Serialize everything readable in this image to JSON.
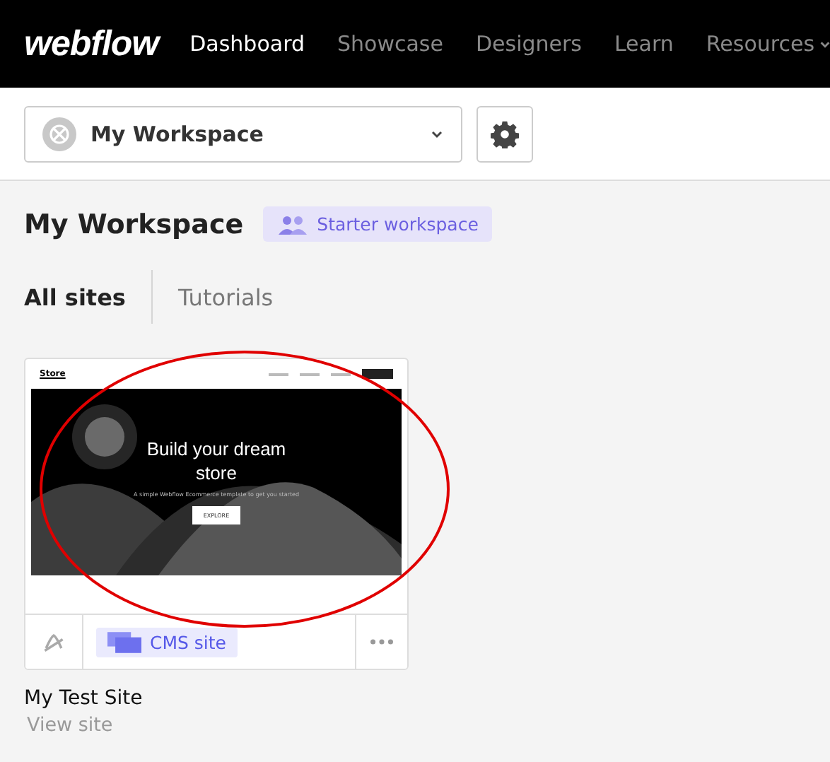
{
  "nav": {
    "logo": "webflow",
    "items": [
      {
        "label": "Dashboard",
        "selected": true
      },
      {
        "label": "Showcase",
        "selected": false
      },
      {
        "label": "Designers",
        "selected": false
      },
      {
        "label": "Learn",
        "selected": false
      },
      {
        "label": "Resources",
        "selected": false,
        "kind": "dropdown"
      }
    ]
  },
  "workspace_select": {
    "value": "My Workspace"
  },
  "heading": "My Workspace",
  "plan_badge": "Starter workspace",
  "tabs": [
    {
      "label": "All sites",
      "selected": true
    },
    {
      "label": "Tutorials",
      "selected": false
    }
  ],
  "site_card": {
    "preview": {
      "brand": "Store",
      "headline": "Build your dream store",
      "subtitle": "A simple Webflow Ecommerce template to get you started",
      "button": "EXPLORE"
    },
    "tag": "CMS site",
    "name": "My Test Site",
    "link": "View site"
  },
  "annotation": {
    "kind": "ellipse"
  }
}
